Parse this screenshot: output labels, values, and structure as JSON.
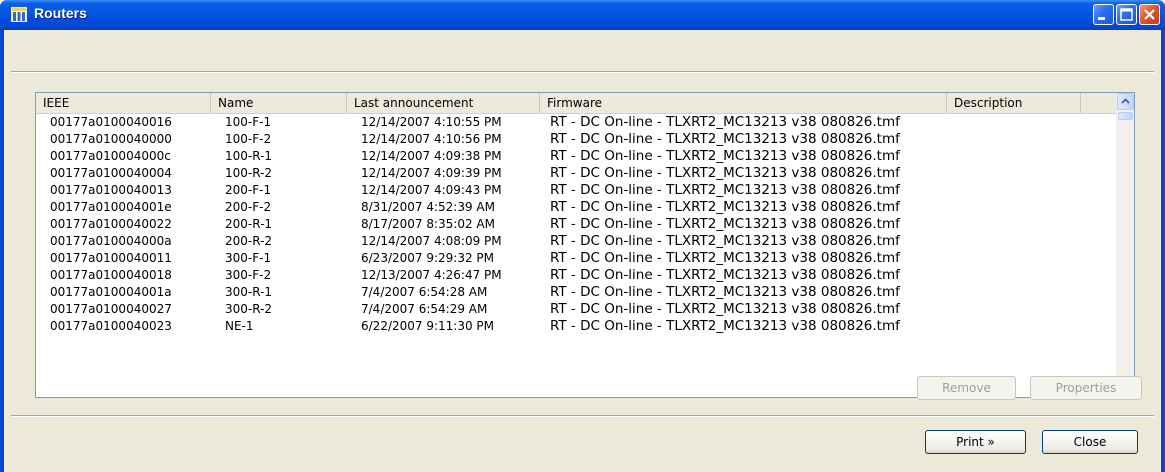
{
  "window": {
    "title": "Routers",
    "colors": {
      "titlebar": "#0352e1",
      "client": "#ece9d8",
      "close_button": "#e0552c"
    }
  },
  "icons": {
    "app": "window-icon",
    "minimize": "minimize-icon",
    "maximize": "maximize-icon",
    "close": "close-icon",
    "scroll_up": "arrow-up-icon",
    "scroll_down": "arrow-down-icon"
  },
  "table": {
    "columns": [
      "IEEE",
      "Name",
      "Last announcement",
      "Firmware",
      "Description"
    ],
    "rows": [
      {
        "ieee": "00177a0100040016",
        "name": "100-F-1",
        "last": "12/14/2007 4:10:55 PM",
        "firmware": "RT - DC On-line - TLXRT2_MC13213 v38 080826.tmf",
        "description": ""
      },
      {
        "ieee": "00177a0100040000",
        "name": "100-F-2",
        "last": "12/14/2007 4:10:56 PM",
        "firmware": "RT - DC On-line - TLXRT2_MC13213 v38 080826.tmf",
        "description": ""
      },
      {
        "ieee": "00177a010004000c",
        "name": "100-R-1",
        "last": "12/14/2007 4:09:38 PM",
        "firmware": "RT - DC On-line - TLXRT2_MC13213 v38 080826.tmf",
        "description": ""
      },
      {
        "ieee": "00177a0100040004",
        "name": "100-R-2",
        "last": "12/14/2007 4:09:39 PM",
        "firmware": "RT - DC On-line - TLXRT2_MC13213 v38 080826.tmf",
        "description": ""
      },
      {
        "ieee": "00177a0100040013",
        "name": "200-F-1",
        "last": "12/14/2007 4:09:43 PM",
        "firmware": "RT - DC On-line - TLXRT2_MC13213 v38 080826.tmf",
        "description": ""
      },
      {
        "ieee": "00177a010004001e",
        "name": "200-F-2",
        "last": "8/31/2007 4:52:39 AM",
        "firmware": "RT - DC On-line - TLXRT2_MC13213 v38 080826.tmf",
        "description": ""
      },
      {
        "ieee": "00177a0100040022",
        "name": "200-R-1",
        "last": "8/17/2007 8:35:02 AM",
        "firmware": "RT - DC On-line - TLXRT2_MC13213 v38 080826.tmf",
        "description": ""
      },
      {
        "ieee": "00177a010004000a",
        "name": "200-R-2",
        "last": "12/14/2007 4:08:09 PM",
        "firmware": "RT - DC On-line - TLXRT2_MC13213 v38 080826.tmf",
        "description": ""
      },
      {
        "ieee": "00177a0100040011",
        "name": "300-F-1",
        "last": "6/23/2007 9:29:32 PM",
        "firmware": "RT - DC On-line - TLXRT2_MC13213 v38 080826.tmf",
        "description": ""
      },
      {
        "ieee": "00177a0100040018",
        "name": "300-F-2",
        "last": "12/13/2007 4:26:47 PM",
        "firmware": "RT - DC On-line - TLXRT2_MC13213 v38 080826.tmf",
        "description": ""
      },
      {
        "ieee": "00177a010004001a",
        "name": "300-R-1",
        "last": "7/4/2007 6:54:28 AM",
        "firmware": "RT - DC On-line - TLXRT2_MC13213 v38 080826.tmf",
        "description": ""
      },
      {
        "ieee": "00177a0100040027",
        "name": "300-R-2",
        "last": "7/4/2007 6:54:29 AM",
        "firmware": "RT - DC On-line - TLXRT2_MC13213 v38 080826.tmf",
        "description": ""
      },
      {
        "ieee": "00177a0100040023",
        "name": "NE-1",
        "last": "6/22/2007 9:11:30 PM",
        "firmware": "RT - DC On-line - TLXRT2_MC13213 v38 080826.tmf",
        "description": ""
      }
    ]
  },
  "buttons": {
    "remove": "Remove",
    "properties": "Properties",
    "print": "Print »",
    "close": "Close"
  }
}
